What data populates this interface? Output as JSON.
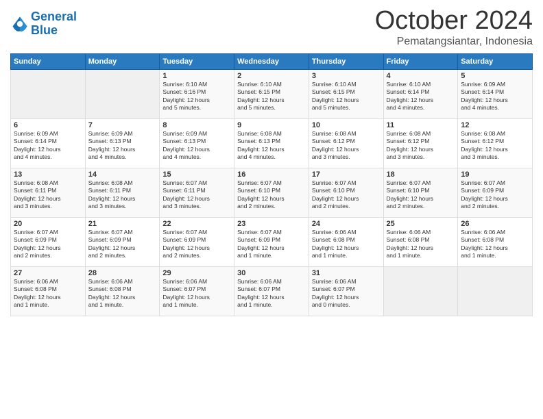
{
  "logo": {
    "line1": "General",
    "line2": "Blue"
  },
  "title": "October 2024",
  "subtitle": "Pematangsiantar, Indonesia",
  "headers": [
    "Sunday",
    "Monday",
    "Tuesday",
    "Wednesday",
    "Thursday",
    "Friday",
    "Saturday"
  ],
  "weeks": [
    [
      {
        "day": "",
        "info": ""
      },
      {
        "day": "",
        "info": ""
      },
      {
        "day": "1",
        "info": "Sunrise: 6:10 AM\nSunset: 6:16 PM\nDaylight: 12 hours\nand 5 minutes."
      },
      {
        "day": "2",
        "info": "Sunrise: 6:10 AM\nSunset: 6:15 PM\nDaylight: 12 hours\nand 5 minutes."
      },
      {
        "day": "3",
        "info": "Sunrise: 6:10 AM\nSunset: 6:15 PM\nDaylight: 12 hours\nand 5 minutes."
      },
      {
        "day": "4",
        "info": "Sunrise: 6:10 AM\nSunset: 6:14 PM\nDaylight: 12 hours\nand 4 minutes."
      },
      {
        "day": "5",
        "info": "Sunrise: 6:09 AM\nSunset: 6:14 PM\nDaylight: 12 hours\nand 4 minutes."
      }
    ],
    [
      {
        "day": "6",
        "info": "Sunrise: 6:09 AM\nSunset: 6:14 PM\nDaylight: 12 hours\nand 4 minutes."
      },
      {
        "day": "7",
        "info": "Sunrise: 6:09 AM\nSunset: 6:13 PM\nDaylight: 12 hours\nand 4 minutes."
      },
      {
        "day": "8",
        "info": "Sunrise: 6:09 AM\nSunset: 6:13 PM\nDaylight: 12 hours\nand 4 minutes."
      },
      {
        "day": "9",
        "info": "Sunrise: 6:08 AM\nSunset: 6:13 PM\nDaylight: 12 hours\nand 4 minutes."
      },
      {
        "day": "10",
        "info": "Sunrise: 6:08 AM\nSunset: 6:12 PM\nDaylight: 12 hours\nand 3 minutes."
      },
      {
        "day": "11",
        "info": "Sunrise: 6:08 AM\nSunset: 6:12 PM\nDaylight: 12 hours\nand 3 minutes."
      },
      {
        "day": "12",
        "info": "Sunrise: 6:08 AM\nSunset: 6:12 PM\nDaylight: 12 hours\nand 3 minutes."
      }
    ],
    [
      {
        "day": "13",
        "info": "Sunrise: 6:08 AM\nSunset: 6:11 PM\nDaylight: 12 hours\nand 3 minutes."
      },
      {
        "day": "14",
        "info": "Sunrise: 6:08 AM\nSunset: 6:11 PM\nDaylight: 12 hours\nand 3 minutes."
      },
      {
        "day": "15",
        "info": "Sunrise: 6:07 AM\nSunset: 6:11 PM\nDaylight: 12 hours\nand 3 minutes."
      },
      {
        "day": "16",
        "info": "Sunrise: 6:07 AM\nSunset: 6:10 PM\nDaylight: 12 hours\nand 2 minutes."
      },
      {
        "day": "17",
        "info": "Sunrise: 6:07 AM\nSunset: 6:10 PM\nDaylight: 12 hours\nand 2 minutes."
      },
      {
        "day": "18",
        "info": "Sunrise: 6:07 AM\nSunset: 6:10 PM\nDaylight: 12 hours\nand 2 minutes."
      },
      {
        "day": "19",
        "info": "Sunrise: 6:07 AM\nSunset: 6:09 PM\nDaylight: 12 hours\nand 2 minutes."
      }
    ],
    [
      {
        "day": "20",
        "info": "Sunrise: 6:07 AM\nSunset: 6:09 PM\nDaylight: 12 hours\nand 2 minutes."
      },
      {
        "day": "21",
        "info": "Sunrise: 6:07 AM\nSunset: 6:09 PM\nDaylight: 12 hours\nand 2 minutes."
      },
      {
        "day": "22",
        "info": "Sunrise: 6:07 AM\nSunset: 6:09 PM\nDaylight: 12 hours\nand 2 minutes."
      },
      {
        "day": "23",
        "info": "Sunrise: 6:07 AM\nSunset: 6:09 PM\nDaylight: 12 hours\nand 1 minute."
      },
      {
        "day": "24",
        "info": "Sunrise: 6:06 AM\nSunset: 6:08 PM\nDaylight: 12 hours\nand 1 minute."
      },
      {
        "day": "25",
        "info": "Sunrise: 6:06 AM\nSunset: 6:08 PM\nDaylight: 12 hours\nand 1 minute."
      },
      {
        "day": "26",
        "info": "Sunrise: 6:06 AM\nSunset: 6:08 PM\nDaylight: 12 hours\nand 1 minute."
      }
    ],
    [
      {
        "day": "27",
        "info": "Sunrise: 6:06 AM\nSunset: 6:08 PM\nDaylight: 12 hours\nand 1 minute."
      },
      {
        "day": "28",
        "info": "Sunrise: 6:06 AM\nSunset: 6:08 PM\nDaylight: 12 hours\nand 1 minute."
      },
      {
        "day": "29",
        "info": "Sunrise: 6:06 AM\nSunset: 6:07 PM\nDaylight: 12 hours\nand 1 minute."
      },
      {
        "day": "30",
        "info": "Sunrise: 6:06 AM\nSunset: 6:07 PM\nDaylight: 12 hours\nand 1 minute."
      },
      {
        "day": "31",
        "info": "Sunrise: 6:06 AM\nSunset: 6:07 PM\nDaylight: 12 hours\nand 0 minutes."
      },
      {
        "day": "",
        "info": ""
      },
      {
        "day": "",
        "info": ""
      }
    ]
  ]
}
